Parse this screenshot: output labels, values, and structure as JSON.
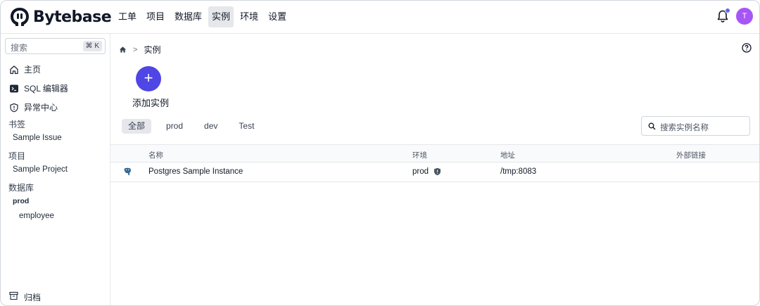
{
  "brand": {
    "name": "Bytebase"
  },
  "nav": {
    "items": [
      "工单",
      "项目",
      "数据库",
      "实例",
      "环境",
      "设置"
    ],
    "active_index": 3
  },
  "user": {
    "initial": "T"
  },
  "sidebar": {
    "search_placeholder": "搜索",
    "shortcut": "⌘ K",
    "items": [
      {
        "label": "主页",
        "icon": "home-icon"
      },
      {
        "label": "SQL 编辑器",
        "icon": "terminal-icon"
      },
      {
        "label": "异常中心",
        "icon": "shield-alert-icon"
      }
    ],
    "sections": {
      "bookmarks": {
        "title": "书签",
        "items": [
          "Sample Issue"
        ]
      },
      "projects": {
        "title": "项目",
        "items": [
          "Sample Project"
        ]
      },
      "databases": {
        "title": "数据库",
        "env": "prod",
        "items": [
          "employee"
        ]
      }
    },
    "archive_label": "归档"
  },
  "breadcrumb": {
    "current": "实例"
  },
  "actions": {
    "add_instance_label": "添加实例"
  },
  "filters": {
    "items": [
      "全部",
      "prod",
      "dev",
      "Test"
    ],
    "active_index": 0
  },
  "table_search": {
    "placeholder": "搜索实例名称"
  },
  "table": {
    "columns": [
      "名称",
      "环境",
      "地址",
      "外部链接"
    ],
    "rows": [
      {
        "name": "Postgres Sample Instance",
        "environment": "prod",
        "address": "/tmp:8083",
        "external_link": ""
      }
    ]
  },
  "colors": {
    "accent": "#4f46e5",
    "avatar": "#a855f7",
    "notification_dot": "#6366f1",
    "active_bg": "#e5e7eb"
  }
}
